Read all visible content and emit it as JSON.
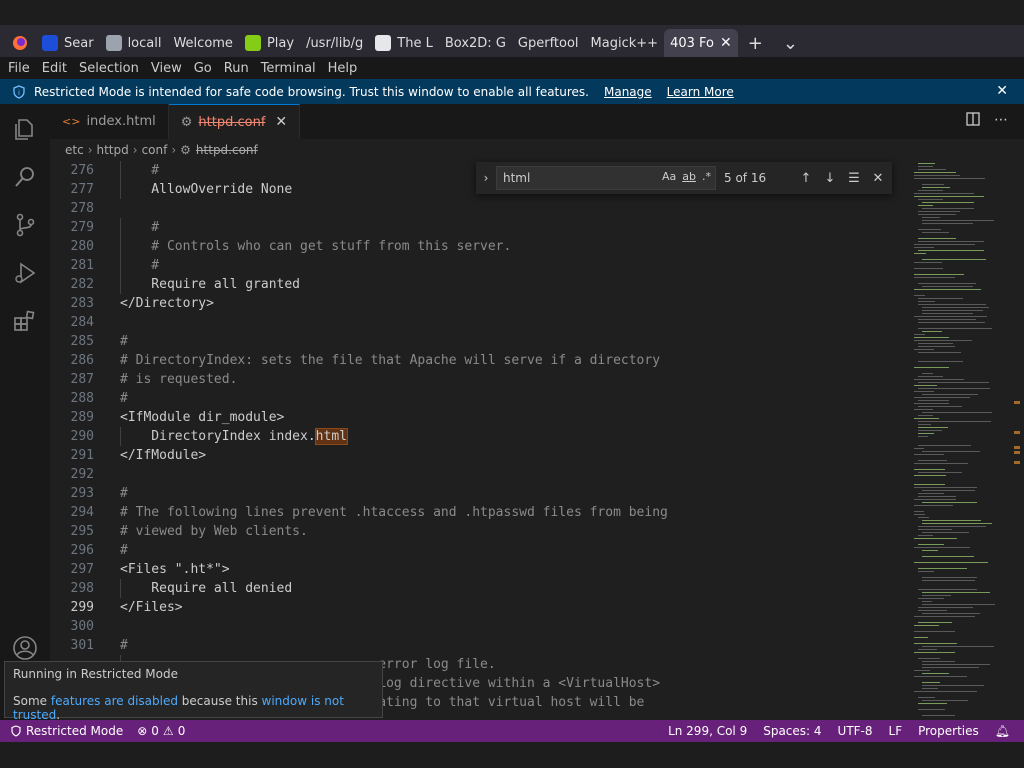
{
  "browser": {
    "tabs": [
      {
        "label": "Sear",
        "color": "#1d4ed8"
      },
      {
        "label": "locall",
        "color": "#9ca3af"
      },
      {
        "label": "Welcome",
        "color": ""
      },
      {
        "label": "Play",
        "color": "#84cc16"
      },
      {
        "label": "/usr/lib/g",
        "color": ""
      },
      {
        "label": "The L",
        "color": "#e5e7eb"
      },
      {
        "label": "Box2D: G",
        "color": ""
      },
      {
        "label": "Gperftool",
        "color": ""
      },
      {
        "label": "Magick++",
        "color": ""
      },
      {
        "label": "403 Fo",
        "color": ""
      }
    ],
    "new_tab": "+",
    "list_tabs": "⌄"
  },
  "menu": [
    "File",
    "Edit",
    "Selection",
    "View",
    "Go",
    "Run",
    "Terminal",
    "Help"
  ],
  "banner": {
    "text": "Restricted Mode is intended for safe code browsing. Trust this window to enable all features.",
    "manage": "Manage",
    "learn_more": "Learn More"
  },
  "editor_tabs": [
    {
      "label": "index.html",
      "active": false
    },
    {
      "label": "httpd.conf",
      "active": true
    }
  ],
  "breadcrumb": [
    "etc",
    "httpd",
    "conf",
    "httpd.conf"
  ],
  "find": {
    "query": "html",
    "opt_case": "Aa",
    "opt_word": "ab",
    "opt_regex": ".*",
    "count": "5 of 16"
  },
  "lines": [
    {
      "n": "276",
      "t": "    #",
      "c": true
    },
    {
      "n": "277",
      "t": "    AllowOverride None",
      "c": false
    },
    {
      "n": "278",
      "t": "",
      "c": false
    },
    {
      "n": "279",
      "t": "    #",
      "c": true
    },
    {
      "n": "280",
      "t": "    # Controls who can get stuff from this server.",
      "c": true
    },
    {
      "n": "281",
      "t": "    #",
      "c": true
    },
    {
      "n": "282",
      "t": "    Require all granted",
      "c": false
    },
    {
      "n": "283",
      "t": "</Directory>",
      "c": false
    },
    {
      "n": "284",
      "t": "",
      "c": false
    },
    {
      "n": "285",
      "t": "#",
      "c": true
    },
    {
      "n": "286",
      "t": "# DirectoryIndex: sets the file that Apache will serve if a directory",
      "c": true
    },
    {
      "n": "287",
      "t": "# is requested.",
      "c": true
    },
    {
      "n": "288",
      "t": "#",
      "c": true
    },
    {
      "n": "289",
      "t": "<IfModule dir_module>",
      "c": false
    },
    {
      "n": "290",
      "t": "    DirectoryIndex index.",
      "c": false,
      "hl": "html"
    },
    {
      "n": "291",
      "t": "</IfModule>",
      "c": false
    },
    {
      "n": "292",
      "t": "",
      "c": false
    },
    {
      "n": "293",
      "t": "#",
      "c": true
    },
    {
      "n": "294",
      "t": "# The following lines prevent .htaccess and .htpasswd files from being",
      "c": true
    },
    {
      "n": "295",
      "t": "# viewed by Web clients.",
      "c": true
    },
    {
      "n": "296",
      "t": "#",
      "c": true
    },
    {
      "n": "297",
      "t": "<Files \".ht*\">",
      "c": false
    },
    {
      "n": "298",
      "t": "    Require all denied",
      "c": false
    },
    {
      "n": "299",
      "t": "</Files>",
      "c": false
    },
    {
      "n": "300",
      "t": "",
      "c": false
    },
    {
      "n": "301",
      "t": "#",
      "c": true
    },
    {
      "n": "",
      "t": "                                 error log file.",
      "c": true
    },
    {
      "n": "",
      "t": "                                 Log directive within a <VirtualHost>",
      "c": true
    },
    {
      "n": "",
      "t": "                                 ating to that virtual host will be",
      "c": true
    }
  ],
  "current_line": "299",
  "tooltip": {
    "title": "Running in Restricted Mode",
    "some": "Some ",
    "link1": "features are disabled",
    "mid": " because this ",
    "link2": "window is not trusted",
    "end": "."
  },
  "status": {
    "mode": "Restricted Mode",
    "errors": "0",
    "warnings": "0",
    "position": "Ln 299, Col 9",
    "spaces": "Spaces: 4",
    "encoding": "UTF-8",
    "eol": "LF",
    "language": "Properties"
  }
}
